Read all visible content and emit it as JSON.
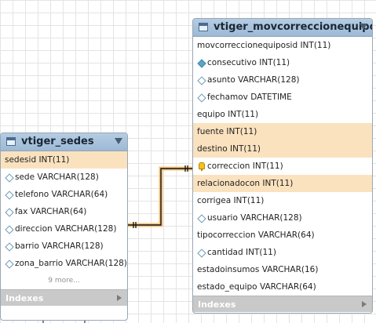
{
  "tables": [
    {
      "name": "vtiger_sedes",
      "columns": [
        {
          "label": "sedesid INT(11)",
          "marker": "none",
          "highlight": true
        },
        {
          "label": "sede VARCHAR(128)",
          "marker": "diamond",
          "highlight": false
        },
        {
          "label": "telefono VARCHAR(64)",
          "marker": "diamond",
          "highlight": false
        },
        {
          "label": "fax VARCHAR(64)",
          "marker": "diamond",
          "highlight": false
        },
        {
          "label": "direccion VARCHAR(128)",
          "marker": "diamond",
          "highlight": false
        },
        {
          "label": "barrio VARCHAR(128)",
          "marker": "diamond",
          "highlight": false
        },
        {
          "label": "zona_barrio VARCHAR(128)",
          "marker": "diamond",
          "highlight": false
        }
      ],
      "more": "9 more...",
      "indexes_label": "Indexes"
    },
    {
      "name": "vtiger_movcorreccionequipos",
      "columns": [
        {
          "label": "movcorreccionequiposid INT(11)",
          "marker": "none",
          "highlight": false
        },
        {
          "label": "consecutivo INT(11)",
          "marker": "diamond-filled",
          "highlight": false
        },
        {
          "label": "asunto VARCHAR(128)",
          "marker": "diamond",
          "highlight": false
        },
        {
          "label": "fechamov DATETIME",
          "marker": "diamond",
          "highlight": false
        },
        {
          "label": "equipo INT(11)",
          "marker": "none",
          "highlight": false
        },
        {
          "label": "fuente INT(11)",
          "marker": "none",
          "highlight": true
        },
        {
          "label": "destino INT(11)",
          "marker": "none",
          "highlight": true
        },
        {
          "label": "correccion INT(11)",
          "marker": "key",
          "highlight": false
        },
        {
          "label": "relacionadocon INT(11)",
          "marker": "none",
          "highlight": true
        },
        {
          "label": "corrigea INT(11)",
          "marker": "none",
          "highlight": false
        },
        {
          "label": "usuario VARCHAR(128)",
          "marker": "diamond",
          "highlight": false
        },
        {
          "label": "tipocorreccion VARCHAR(64)",
          "marker": "none",
          "highlight": false
        },
        {
          "label": "cantidad INT(11)",
          "marker": "diamond",
          "highlight": false
        },
        {
          "label": "estadoinsumos VARCHAR(16)",
          "marker": "none",
          "highlight": false
        },
        {
          "label": "estado_equipo VARCHAR(64)",
          "marker": "none",
          "highlight": false
        }
      ],
      "indexes_label": "Indexes"
    }
  ],
  "colors": {
    "header": "#a9c4de",
    "highlight_row": "#fbe2bf",
    "relationship_line": "#e8a33a",
    "grid": "#e4e4e4"
  }
}
